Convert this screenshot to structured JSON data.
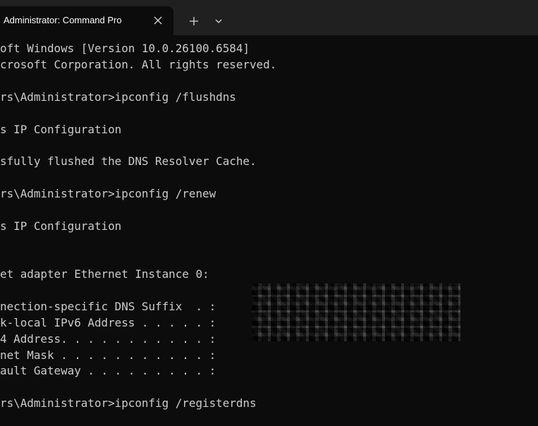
{
  "tab": {
    "title": "Administrator: Command Pro"
  },
  "icons": {
    "close": "close-icon",
    "new_tab": "plus-icon",
    "dropdown": "chevron-down-icon"
  },
  "terminal": {
    "lines": [
      "oft Windows [Version 10.0.26100.6584]",
      "crosoft Corporation. All rights reserved.",
      "rs\\Administrator>ipconfig /flushdns",
      "s IP Configuration",
      "sfully flushed the DNS Resolver Cache.",
      "rs\\Administrator>ipconfig /renew",
      "s IP Configuration",
      "et adapter Ethernet Instance 0:",
      "nection-specific DNS Suffix  . :",
      "k-local IPv6 Address . . . . . :",
      "4 Address. . . . . . . . . . . :",
      "net Mask . . . . . . . . . . . :",
      "ault Gateway . . . . . . . . . :",
      "rs\\Administrator>ipconfig /registerdns"
    ]
  }
}
